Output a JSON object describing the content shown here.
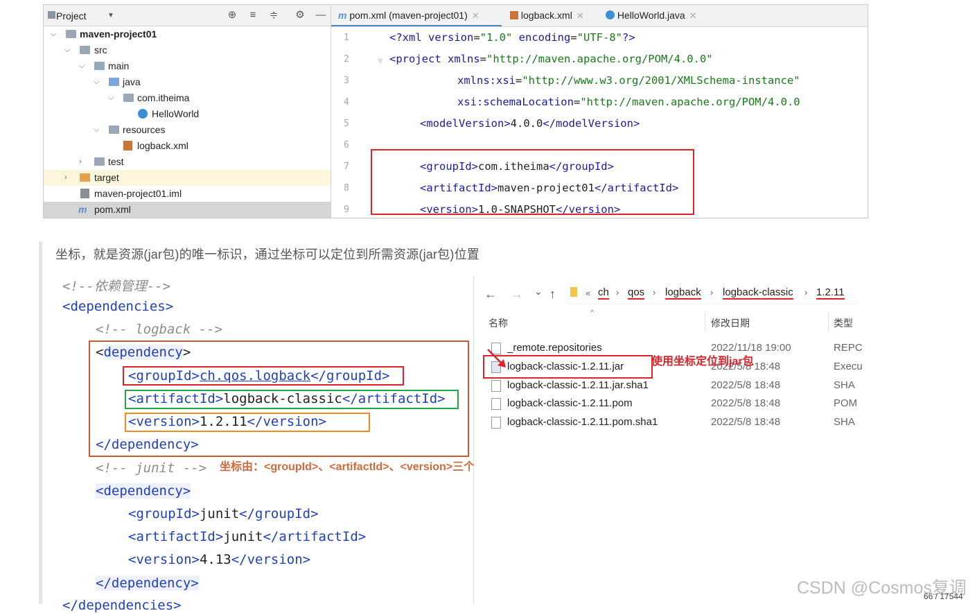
{
  "ide": {
    "project_header": {
      "title": "Project",
      "dropdown_icon": "chevron-down-icon",
      "icons": [
        "crosshair-icon",
        "expand-all-icon",
        "collapse-all-icon",
        "gear-icon",
        "minimize-icon"
      ]
    },
    "tree": [
      {
        "label": "maven-project01",
        "icon": "module-folder-icon"
      },
      {
        "label": "src",
        "icon": "folder-icon"
      },
      {
        "label": "main",
        "icon": "folder-icon"
      },
      {
        "label": "java",
        "icon": "source-folder-icon"
      },
      {
        "label": "com.itheima",
        "icon": "package-icon"
      },
      {
        "label": "HelloWorld",
        "icon": "java-class-icon"
      },
      {
        "label": "resources",
        "icon": "resources-folder-icon"
      },
      {
        "label": "logback.xml",
        "icon": "xml-file-icon"
      },
      {
        "label": "test",
        "icon": "folder-icon"
      },
      {
        "label": "target",
        "icon": "excluded-folder-icon"
      },
      {
        "label": "maven-project01.iml",
        "icon": "iml-file-icon"
      },
      {
        "label": "pom.xml",
        "icon": "maven-icon"
      }
    ],
    "tabs": [
      {
        "label": "pom.xml (maven-project01)",
        "icon": "maven-icon",
        "active": true
      },
      {
        "label": "logback.xml",
        "icon": "xml-file-icon",
        "active": false
      },
      {
        "label": "HelloWorld.java",
        "icon": "java-class-icon",
        "active": false
      }
    ],
    "line_numbers": [
      "1",
      "2",
      "3",
      "4",
      "5",
      "6",
      "7",
      "8",
      "9"
    ],
    "code": {
      "l1_a": "<?",
      "l1_b": "xml ",
      "l1_c": "version",
      "l1_d": "=",
      "l1_e": "\"1.0\"",
      "l1_f": " encoding",
      "l1_g": "=",
      "l1_h": "\"UTF-8\"",
      "l1_i": "?>",
      "l2_a": "<project ",
      "l2_b": "xmlns",
      "l2_c": "=",
      "l2_d": "\"http://maven.apache.org/POM/4.0.0\"",
      "l3_a": "xmlns:xsi",
      "l3_b": "=",
      "l3_c": "\"http://www.w3.org/2001/XMLSchema-instance\"",
      "l4_a": "xsi:schemaLocation",
      "l4_b": "=",
      "l4_c": "\"http://maven.apache.org/POM/4.0.0",
      "l5_a": "<modelVersion>",
      "l5_b": "4.0.0",
      "l5_c": "</modelVersion>",
      "l7_a": "<groupId>",
      "l7_b": "com.itheima",
      "l7_c": "</groupId>",
      "l8_a": "<artifactId>",
      "l8_b": "maven-project01",
      "l8_c": "</artifactId>",
      "l9_a": "<version>",
      "l9_b": "1.0-SNAPSHOT",
      "l9_c": "</version>"
    }
  },
  "caption": "坐标，就是资源(jar包)的唯一标识，通过坐标可以定位到所需资源(jar包)位置",
  "snippet": {
    "c1": "<!--依赖管理-->",
    "deps_open": "<dependencies>",
    "c_logback": "<!-- logback -->",
    "dep1_open_lt": "<",
    "dep1_open_name": "dependency",
    "dep1_open_gt": ">",
    "g_open": "<groupId>",
    "g_val": "ch.qos.logback",
    "g_close": "</groupId>",
    "a_open": "<artifactId>",
    "a_val": "logback-classic",
    "a_close": "</artifactId>",
    "v_open": "<version>",
    "v_val": "1.2.11",
    "v_close": "</version>",
    "dep1_close": "</dependency>",
    "c_junit": "<!-- junit -->",
    "dep2_open": "<dependency>",
    "g2_open": "<groupId>",
    "g2_val": "junit",
    "g2_close": "</groupId>",
    "a2_open": "<artifactId>",
    "a2_val": "junit",
    "a2_close": "</artifactId>",
    "v2_open": "<version>",
    "v2_val": "4.13",
    "v2_close": "</version>",
    "dep2_close": "</dependency>",
    "deps_close": "</dependencies>",
    "annotation": "坐标由：<groupId>、<artifactId>、<version>三个标签组成"
  },
  "explorer": {
    "nav": {
      "back": "←",
      "forward": "→",
      "recent": "⌄",
      "up": "↑"
    },
    "crumbs": [
      "ch",
      "qos",
      "logback",
      "logback-classic",
      "1.2.11"
    ],
    "crumb_prefix": "«",
    "columns": {
      "name": "名称",
      "date": "修改日期",
      "type": "类型"
    },
    "files": [
      {
        "name": "_remote.repositories",
        "date": "2022/11/18 19:00",
        "type": "REPC"
      },
      {
        "name": "logback-classic-1.2.11.jar",
        "date": "2022/5/8 18:48",
        "type": "Execu"
      },
      {
        "name": "logback-classic-1.2.11.jar.sha1",
        "date": "2022/5/8 18:48",
        "type": "SHA"
      },
      {
        "name": "logback-classic-1.2.11.pom",
        "date": "2022/5/8 18:48",
        "type": "POM"
      },
      {
        "name": "logback-classic-1.2.11.pom.sha1",
        "date": "2022/5/8 18:48",
        "type": "SHA"
      }
    ],
    "annotation": "使用坐标定位到jar包"
  },
  "watermark": "CSDN @Cosmos复调",
  "page_counter": "66 / 17544"
}
